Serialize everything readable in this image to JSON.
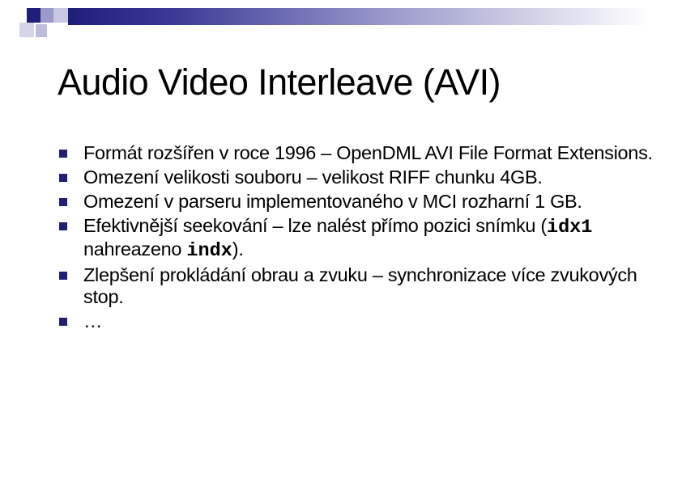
{
  "slide": {
    "title": "Audio Video Interleave (AVI)",
    "bullets": [
      {
        "text": "Formát rozšířen v roce 1996 – OpenDML AVI File Format Extensions."
      },
      {
        "text": "Omezení velikosti souboru – velikost RIFF chunku 4GB."
      },
      {
        "text": "Omezení v parseru implementovaného v MCI rozharní 1 GB."
      },
      {
        "pre": "Efektivnější seekování – lze nalést přímo pozici snímku (",
        "code1": "idx1",
        "mid": " nahreazeno ",
        "code2": "indx",
        "post": ")."
      },
      {
        "text": "Zlepšení prokládání obrau a zvuku – synchronizace více zvukových stop."
      },
      {
        "text": "…"
      }
    ]
  },
  "colors": {
    "accent": "#1f1f7a",
    "accent_light": "#9a9acb",
    "background": "#ffffff",
    "text": "#000000"
  }
}
